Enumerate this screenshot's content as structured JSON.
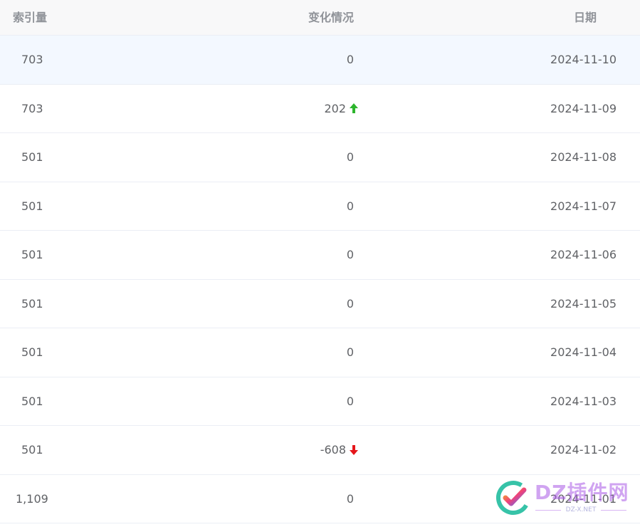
{
  "table": {
    "headers": {
      "index": "索引量",
      "change": "变化情况",
      "date": "日期"
    },
    "rows": [
      {
        "index": "703",
        "change": "0",
        "trend": "none",
        "date": "2024-11-10"
      },
      {
        "index": "703",
        "change": "202",
        "trend": "up",
        "date": "2024-11-09"
      },
      {
        "index": "501",
        "change": "0",
        "trend": "none",
        "date": "2024-11-08"
      },
      {
        "index": "501",
        "change": "0",
        "trend": "none",
        "date": "2024-11-07"
      },
      {
        "index": "501",
        "change": "0",
        "trend": "none",
        "date": "2024-11-06"
      },
      {
        "index": "501",
        "change": "0",
        "trend": "none",
        "date": "2024-11-05"
      },
      {
        "index": "501",
        "change": "0",
        "trend": "none",
        "date": "2024-11-04"
      },
      {
        "index": "501",
        "change": "0",
        "trend": "none",
        "date": "2024-11-03"
      },
      {
        "index": "501",
        "change": "-608",
        "trend": "down",
        "date": "2024-11-02"
      },
      {
        "index": "1,109",
        "change": "0",
        "trend": "none",
        "date": "2024-11-01"
      }
    ],
    "highlight_row": 0
  },
  "colors": {
    "up": "#2db52d",
    "down": "#e5161b",
    "highlight_bg": "#f3f8ff",
    "header_bg": "#f8f8f9"
  },
  "watermark": {
    "text": "DZ插件网",
    "sub": "DZ-X.NET"
  }
}
